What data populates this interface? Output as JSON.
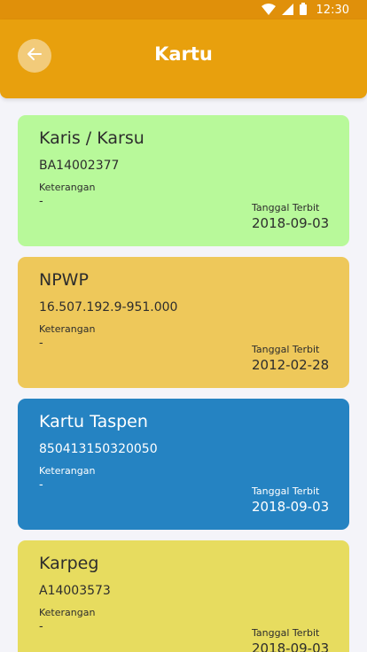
{
  "status_bar": {
    "time": "12:30"
  },
  "header": {
    "title": "Kartu"
  },
  "cards": [
    {
      "name": "Karis / Karsu",
      "number": "BA14002377",
      "info_label": "Keterangan",
      "info_value": "-",
      "date_label": "Tanggal Terbit",
      "date_value": "2018-09-03",
      "color": "#b8f99a"
    },
    {
      "name": "NPWP",
      "number": "16.507.192.9-951.000",
      "info_label": "Keterangan",
      "info_value": "-",
      "date_label": "Tanggal Terbit",
      "date_value": "2012-02-28",
      "color": "#eec85a"
    },
    {
      "name": "Kartu Taspen",
      "number": "850413150320050",
      "info_label": "Keterangan",
      "info_value": "-",
      "date_label": "Tanggal Terbit",
      "date_value": "2018-09-03",
      "color": "#2583c2"
    },
    {
      "name": "Karpeg",
      "number": "A14003573",
      "info_label": "Keterangan",
      "info_value": "-",
      "date_label": "Tanggal Terbit",
      "date_value": "2018-09-03",
      "color": "#e7dc5f"
    }
  ]
}
